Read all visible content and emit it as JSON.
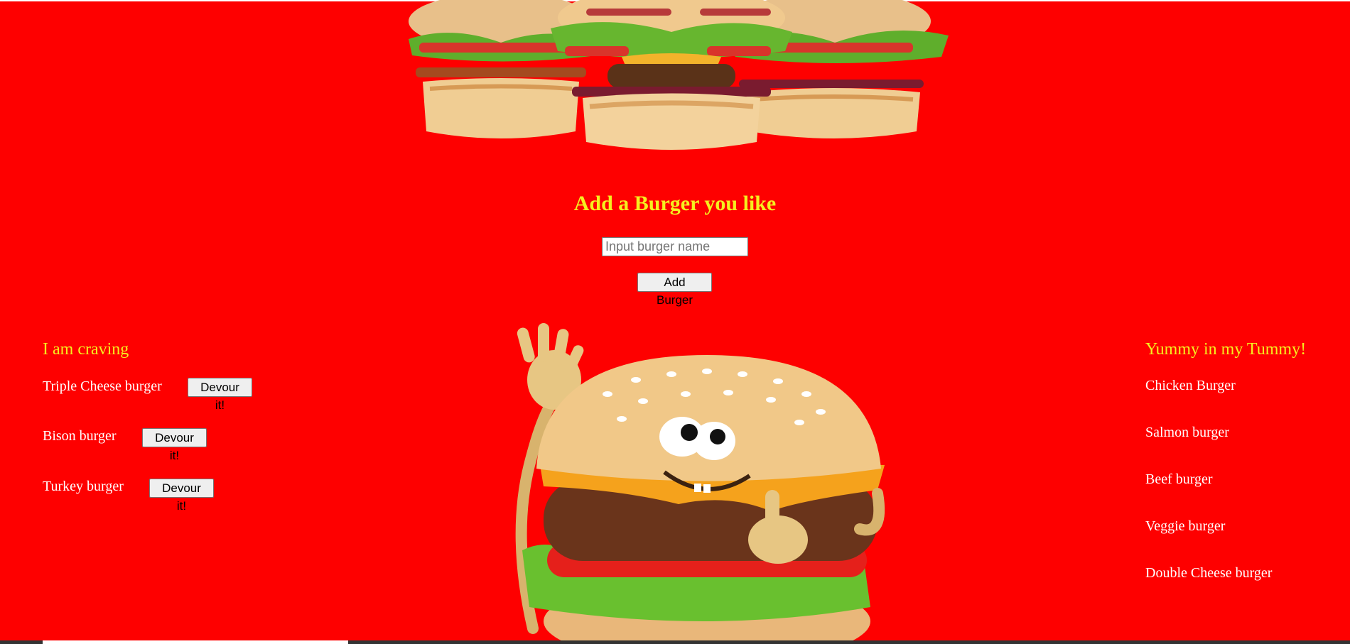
{
  "form": {
    "title": "Add a Burger you like",
    "input_placeholder": "Input burger name",
    "input_value": "",
    "submit_label": "Add Burger"
  },
  "craving": {
    "title": "I am craving",
    "items": [
      {
        "name": "Triple Cheese burger",
        "button": "Devour it!"
      },
      {
        "name": "Bison burger",
        "button": "Devour it!"
      },
      {
        "name": "Turkey burger",
        "button": "Devour it!"
      }
    ]
  },
  "devoured": {
    "title": "Yummy in my Tummy!",
    "items": [
      "Chicken Burger",
      "Salmon burger",
      "Beef burger",
      "Veggie burger",
      "Double Cheese burger"
    ]
  },
  "colors": {
    "background": "#fe0000",
    "heading": "#f5ef1f",
    "item_text": "#ffffff"
  },
  "icons": [
    "burger-trio-banner",
    "waving-burger-mascot"
  ]
}
